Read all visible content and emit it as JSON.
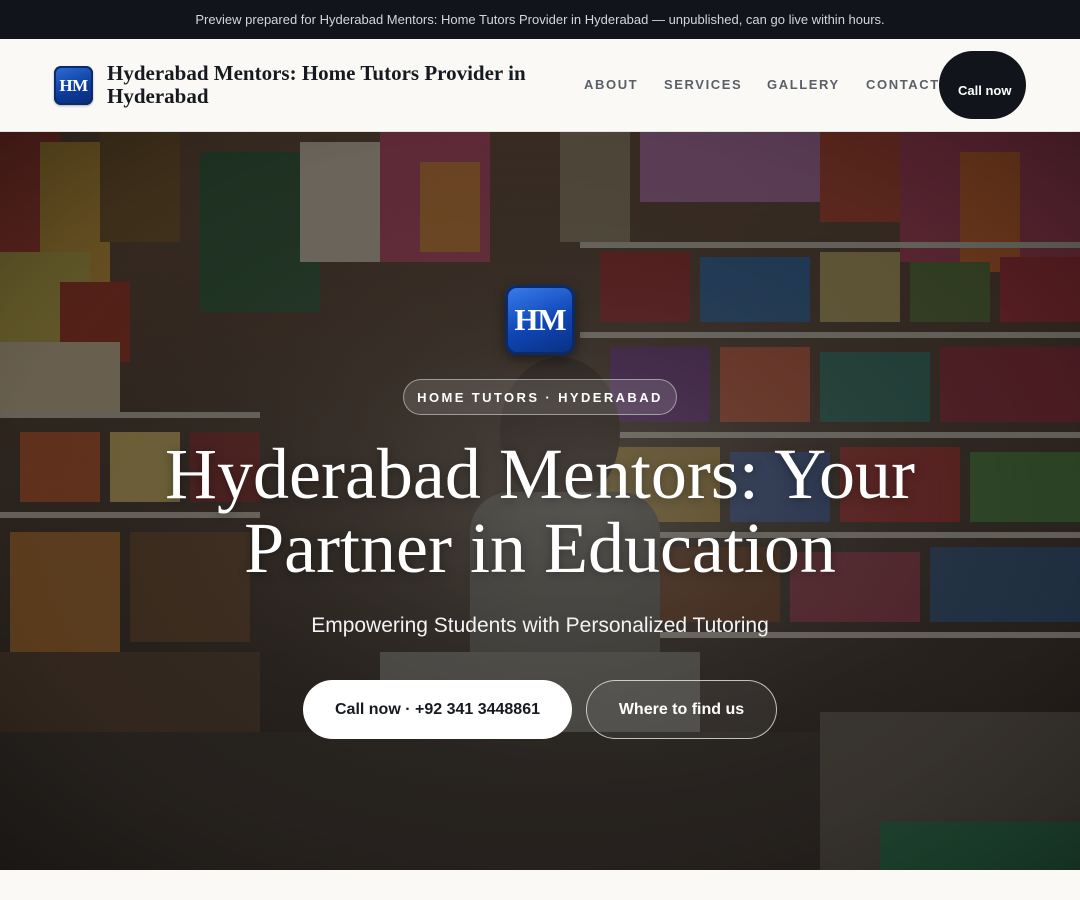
{
  "preview_bar": {
    "text": "Preview prepared for Hyderabad Mentors: Home Tutors Provider in Hyderabad — unpublished, can go live within hours."
  },
  "header": {
    "logo_text": "HM",
    "brand_name": "Hyderabad Mentors: Home Tutors Provider in Hyderabad",
    "nav": {
      "about": "ABOUT",
      "services": "SERVICES",
      "gallery": "GALLERY",
      "contact": "CONTACT"
    },
    "call_button": "Call now"
  },
  "hero": {
    "logo_text": "HM",
    "eyebrow": "HOME TUTORS · HYDERABAD",
    "title": "Hyderabad Mentors: Your Partner in Education",
    "subtitle": "Empowering Students with Personalized Tutoring",
    "primary_button": "Call now · +92 341 3448861",
    "secondary_button": "Where to find us",
    "background_image": "shop-interior-photo"
  },
  "colors": {
    "dark": "#11141a",
    "brand_blue": "#0f45b4",
    "page_background": "#faf9f6"
  }
}
